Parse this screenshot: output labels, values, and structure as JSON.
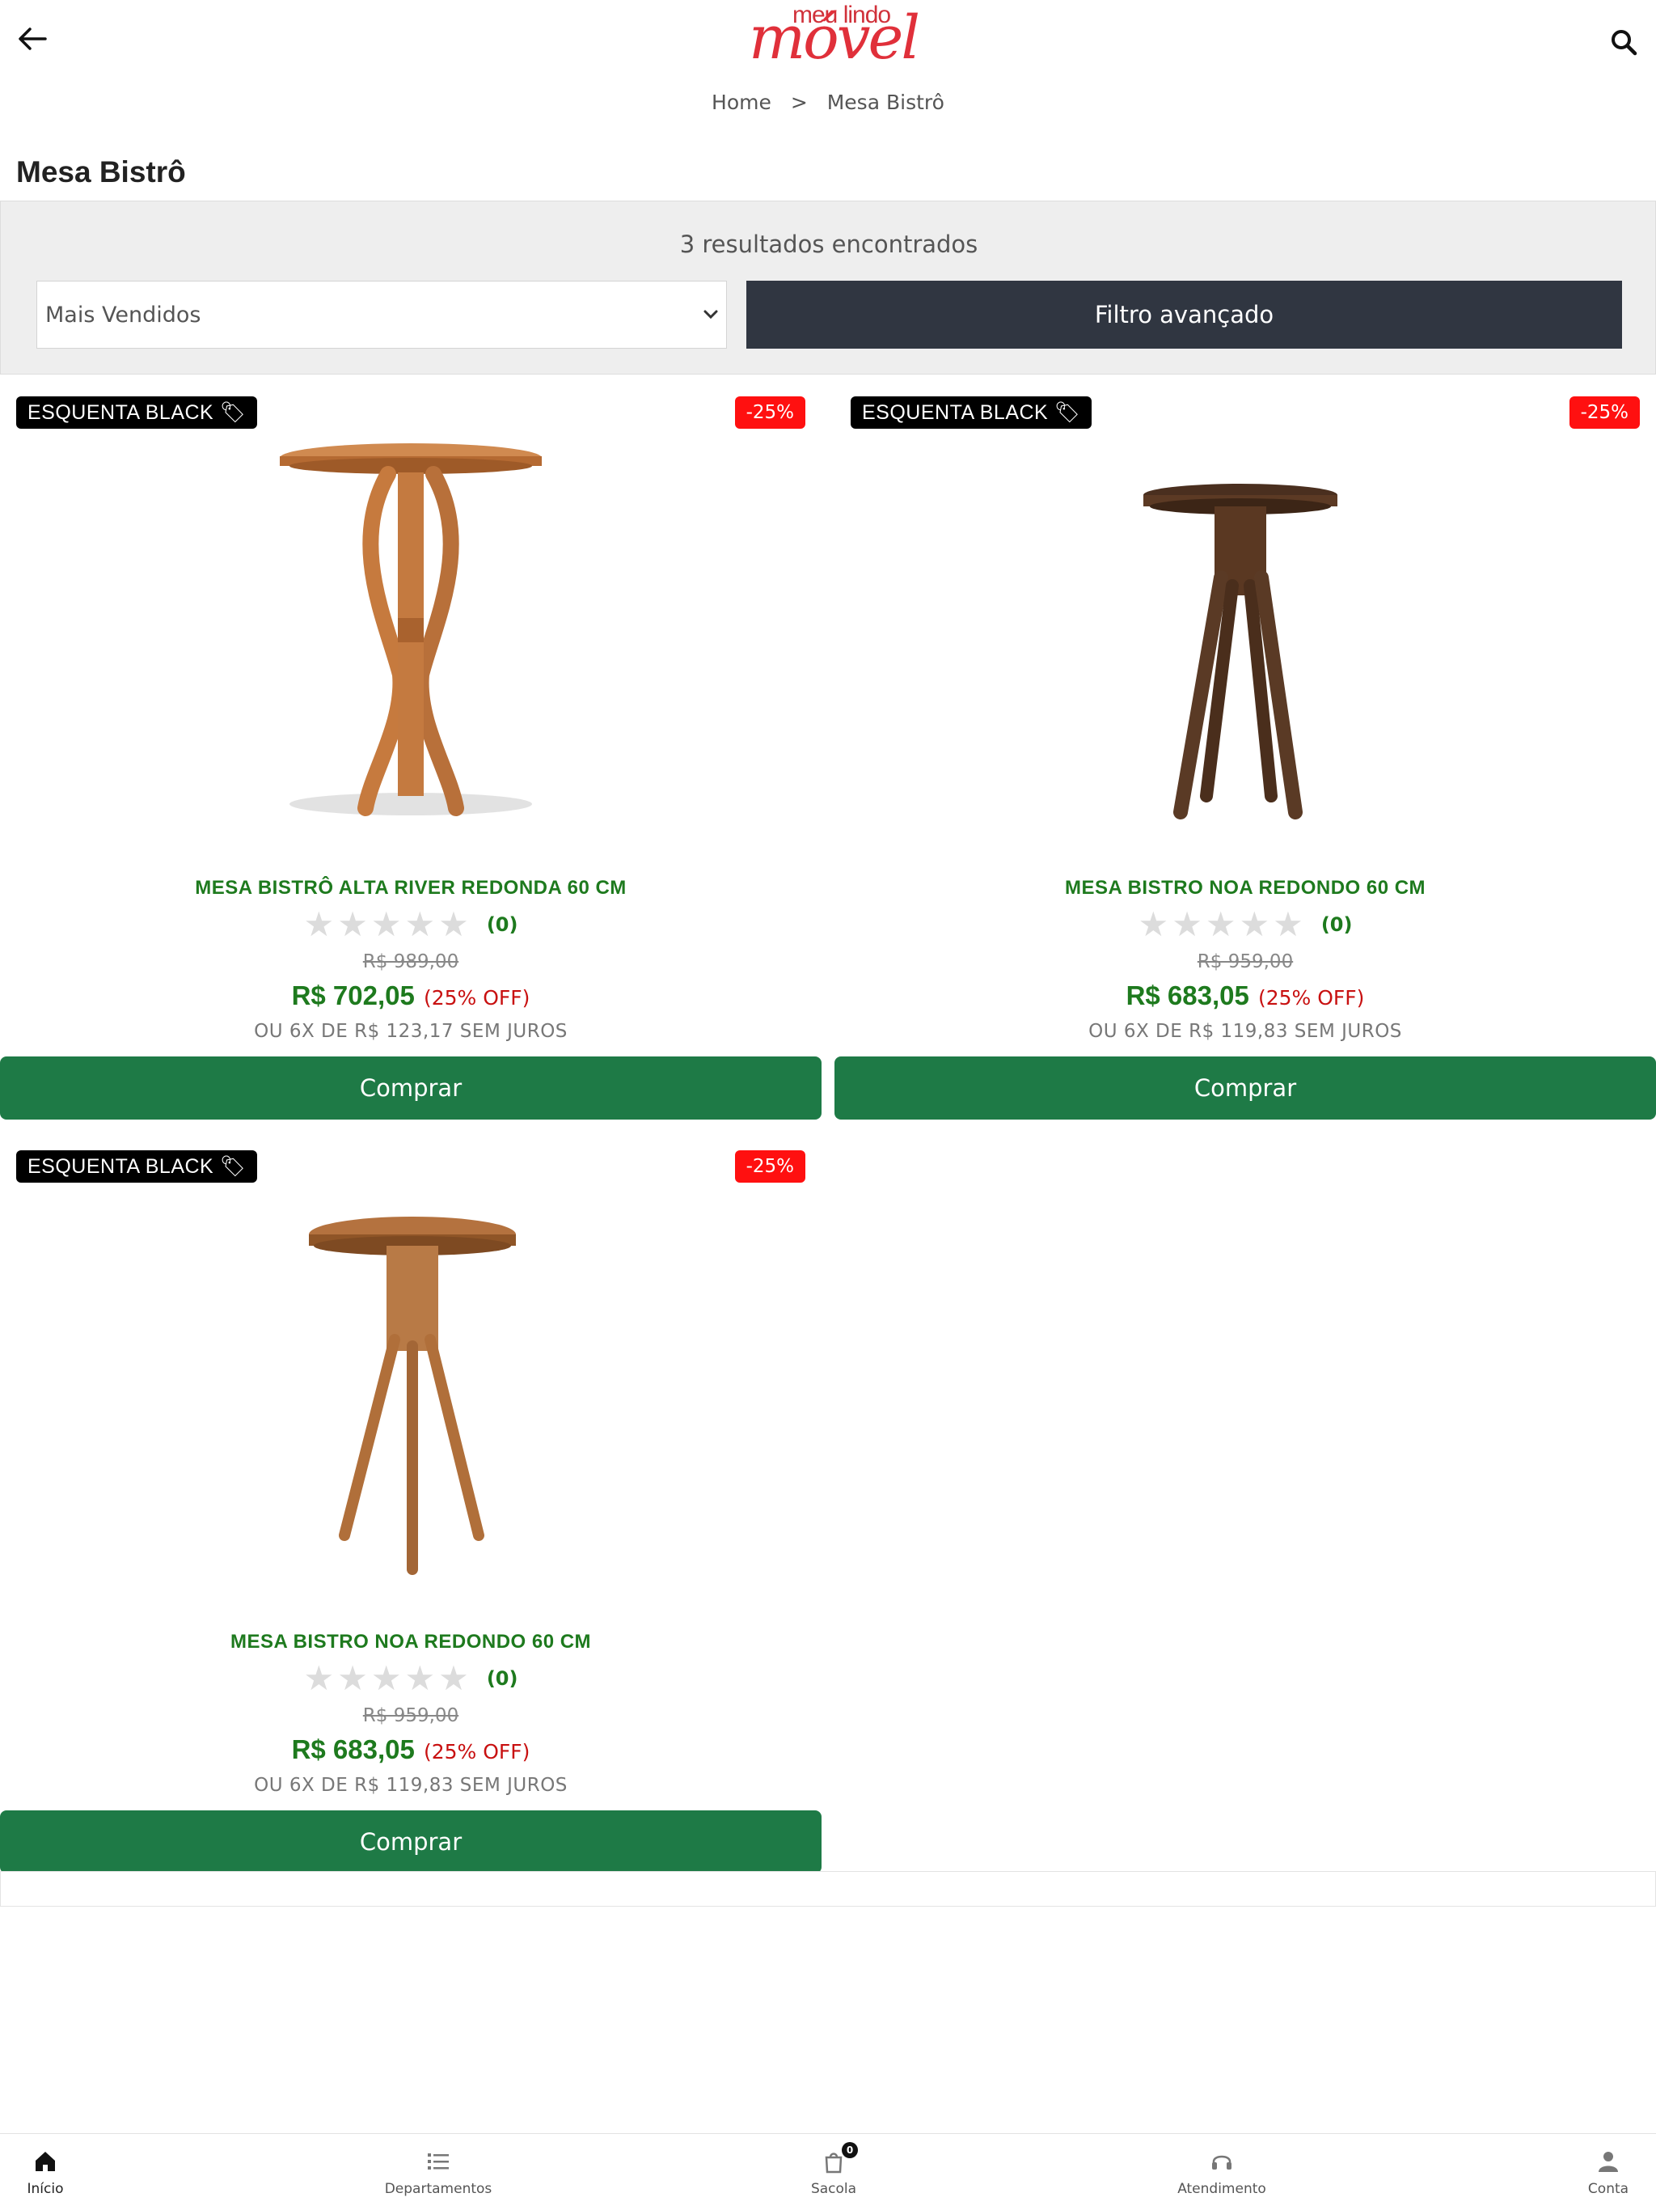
{
  "header": {
    "logo_small": "meu lindo",
    "logo_big": "móvel",
    "breadcrumb": {
      "home": "Home",
      "separator": ">",
      "current": "Mesa Bistrô"
    }
  },
  "page_title": "Mesa Bistrô",
  "filters": {
    "results": "3 resultados encontrados",
    "sort_selected": "Mais Vendidos",
    "advanced_filter_label": "Filtro avançado"
  },
  "products": [
    {
      "badge": "ESQUENTA BLACK 🏷",
      "discount": "-25%",
      "name": "MESA BISTRÔ ALTA RIVER REDONDA 60 CM",
      "rating_count": "(0)",
      "old_price": "R$ 989,00",
      "price": "R$ 702,05",
      "off": "(25% OFF)",
      "installments": "OU 6X DE R$ 123,17 SEM JUROS",
      "buy_label": "Comprar"
    },
    {
      "badge": "ESQUENTA BLACK 🏷",
      "discount": "-25%",
      "name": "MESA BISTRO NOA REDONDO 60 CM",
      "rating_count": "(0)",
      "old_price": "R$ 959,00",
      "price": "R$ 683,05",
      "off": "(25% OFF)",
      "installments": "OU 6X DE R$ 119,83 SEM JUROS",
      "buy_label": "Comprar"
    },
    {
      "badge": "ESQUENTA BLACK 🏷",
      "discount": "-25%",
      "name": "MESA BISTRO NOA REDONDO 60 CM",
      "rating_count": "(0)",
      "old_price": "R$ 959,00",
      "price": "R$ 683,05",
      "off": "(25% OFF)",
      "installments": "OU 6X DE R$ 119,83 SEM JUROS",
      "buy_label": "Comprar"
    }
  ],
  "bottom_nav": {
    "home": "Início",
    "departments": "Departamentos",
    "cart": "Sacola",
    "cart_count": "0",
    "support": "Atendimento",
    "account": "Conta"
  },
  "colors": {
    "brand_red": "#e0303a",
    "price_green": "#1e7a1e",
    "buy_button": "#1e7a46",
    "filter_button": "#303641",
    "discount_badge": "#ff1010"
  }
}
